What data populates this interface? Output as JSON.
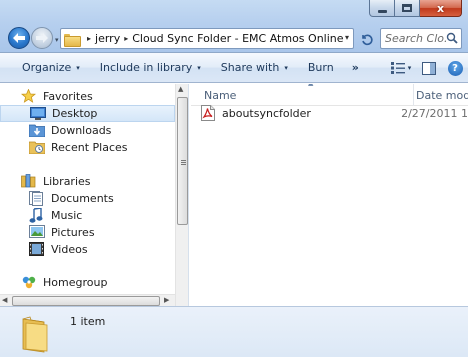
{
  "window": {
    "caption_buttons": {
      "minimize": "",
      "maximize": "",
      "close": "x"
    }
  },
  "navigation": {
    "back_icon": "back-arrow-icon",
    "forward_icon": "forward-arrow-icon",
    "history_dropdown": "▾"
  },
  "address_bar": {
    "crumbs": [
      "jerry",
      "Cloud Sync Folder - EMC Atmos Online"
    ],
    "separator": "▸",
    "dropdown": "▾"
  },
  "search": {
    "placeholder": "Search Clo..."
  },
  "toolbar": {
    "organize": "Organize",
    "include_in_library": "Include in library",
    "share_with": "Share with",
    "burn": "Burn",
    "more": "»",
    "caret": "▾"
  },
  "nav_pane": {
    "favorites": {
      "label": "Favorites",
      "items": [
        "Desktop",
        "Downloads",
        "Recent Places"
      ]
    },
    "libraries": {
      "label": "Libraries",
      "items": [
        "Documents",
        "Music",
        "Pictures",
        "Videos"
      ]
    },
    "homegroup": {
      "label": "Homegroup"
    },
    "selected": "Desktop"
  },
  "file_list": {
    "columns": [
      "Name",
      "Date modifi"
    ],
    "files": [
      {
        "name": "aboutsyncfolder",
        "date": "2/27/2011 1",
        "icon": "pdf-file-icon"
      }
    ]
  },
  "details_pane": {
    "item_count": "1 item"
  },
  "colors": {
    "chrome": "#b6cfee",
    "command_bar": "#dbe7f6",
    "selection": "#d4e6f8",
    "close_button": "#c0391b",
    "link_text": "#1e395b"
  }
}
